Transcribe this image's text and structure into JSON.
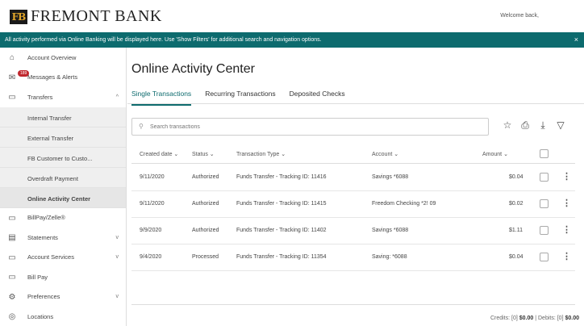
{
  "header": {
    "bank_name": "FREMONT BANK",
    "logo_mark": "FB",
    "welcome": "Welcome back,"
  },
  "banner": {
    "text": "All activity performed via Online Banking will be displayed here. Use 'Show Filters' for additional search and navigation options.",
    "close": "×"
  },
  "sidebar": {
    "items": [
      {
        "label": "Account Overview",
        "icon": "home-icon",
        "glyph": "⌂"
      },
      {
        "label": "Messages & Alerts",
        "icon": "mail-icon",
        "glyph": "✉",
        "badge": "189"
      },
      {
        "label": "Transfers",
        "icon": "transfer-icon",
        "glyph": "▭",
        "chevron": "^"
      },
      {
        "label": "BillPay/Zelle®",
        "icon": "billpay-icon",
        "glyph": "▭"
      },
      {
        "label": "Statements",
        "icon": "statements-icon",
        "glyph": "▤",
        "chevron": "v"
      },
      {
        "label": "Account Services",
        "icon": "services-icon",
        "glyph": "▭",
        "chevron": "v"
      },
      {
        "label": "Bill Pay",
        "icon": "billpay2-icon",
        "glyph": "▭"
      },
      {
        "label": "Preferences",
        "icon": "gear-icon",
        "glyph": "⚙",
        "chevron": "v"
      },
      {
        "label": "Locations",
        "icon": "location-icon",
        "glyph": "◎"
      }
    ],
    "transfer_subitems": [
      "Internal Transfer",
      "External Transfer",
      "FB Customer to Custo...",
      "Overdraft Payment",
      "Online Activity Center"
    ]
  },
  "main": {
    "title": "Online Activity Center",
    "tabs": [
      "Single Transactions",
      "Recurring Transactions",
      "Deposited Checks"
    ],
    "search_placeholder": "Search transactions",
    "columns": [
      "Created date ⌄",
      "Status ⌄",
      "Transaction Type ⌄",
      "Account ⌄",
      "Amount ⌄"
    ],
    "rows": [
      {
        "date": "9/11/2020",
        "status": "Authorized",
        "type": "Funds Transfer - Tracking ID: 11416",
        "account": "Savings *6088",
        "amount": "$0.04"
      },
      {
        "date": "9/11/2020",
        "status": "Authorized",
        "type": "Funds Transfer - Tracking ID: 11415",
        "account": "Freedom Checking *2! 09",
        "amount": "$0.02"
      },
      {
        "date": "9/9/2020",
        "status": "Authorized",
        "type": "Funds Transfer - Tracking ID: 11402",
        "account": "Savings *6088",
        "amount": "$1.11"
      },
      {
        "date": "9/4/2020",
        "status": "Processed",
        "type": "Funds Transfer - Tracking ID: 11354",
        "account": "Saving: *6088",
        "amount": "$0.04"
      }
    ],
    "totals": {
      "credits_label": "Credits: [0]",
      "credits_value": "$0.00",
      "debits_label": "| Debits: [0]",
      "debits_value": "$0.00"
    }
  }
}
